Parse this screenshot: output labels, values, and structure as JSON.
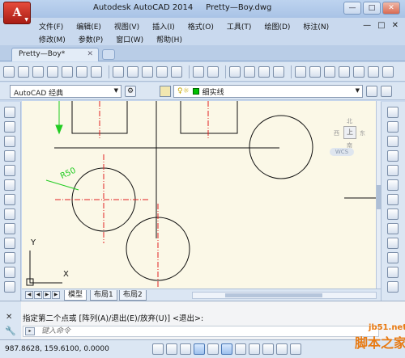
{
  "app": {
    "button_letter": "A",
    "title": "Autodesk AutoCAD 2014     Pretty—Boy.dwg",
    "window_controls": [
      "—",
      "□",
      "✕"
    ]
  },
  "menus": {
    "row1": [
      "文件(F)",
      "编辑(E)",
      "视图(V)",
      "插入(I)",
      "格式(O)",
      "工具(T)",
      "绘图(D)",
      "标注(N)"
    ],
    "row2": [
      "修改(M)",
      "参数(P)",
      "窗口(W)",
      "帮助(H)"
    ],
    "mdi_controls": [
      "—",
      "□",
      "✕"
    ]
  },
  "tabs": {
    "document": "Pretty—Boy*",
    "close": "✕"
  },
  "toolbar": {
    "workspace": "AutoCAD 经典",
    "layer_state": "♀☼",
    "layer_name": "细实线",
    "layer_color": "#00c000"
  },
  "canvas": {
    "dimension_label": "R50",
    "viewcube_face": "上",
    "viewcube_dirs": {
      "n": "北",
      "s": "南",
      "w": "西",
      "e": "东"
    },
    "wcs": "WCS",
    "ucs_y": "Y",
    "ucs_x": "X",
    "colors": {
      "background": "#fbf8e7",
      "geometry": "#111111",
      "centerline": "#e02020",
      "dimension": "#22cc22"
    }
  },
  "layout_tabs": [
    "模型",
    "布局1",
    "布局2"
  ],
  "command": {
    "history": "指定第二个点或 [阵列(A)/退出(E)/放弃(U)] <退出>:",
    "placeholder": "键入命令",
    "close_icon": "✕",
    "wrench_icon": "🔧"
  },
  "status": {
    "coordinates": "987.8628, 159.6100, 0.0000"
  },
  "watermark": {
    "site": "jb51.net",
    "brand": "脚本之家"
  }
}
